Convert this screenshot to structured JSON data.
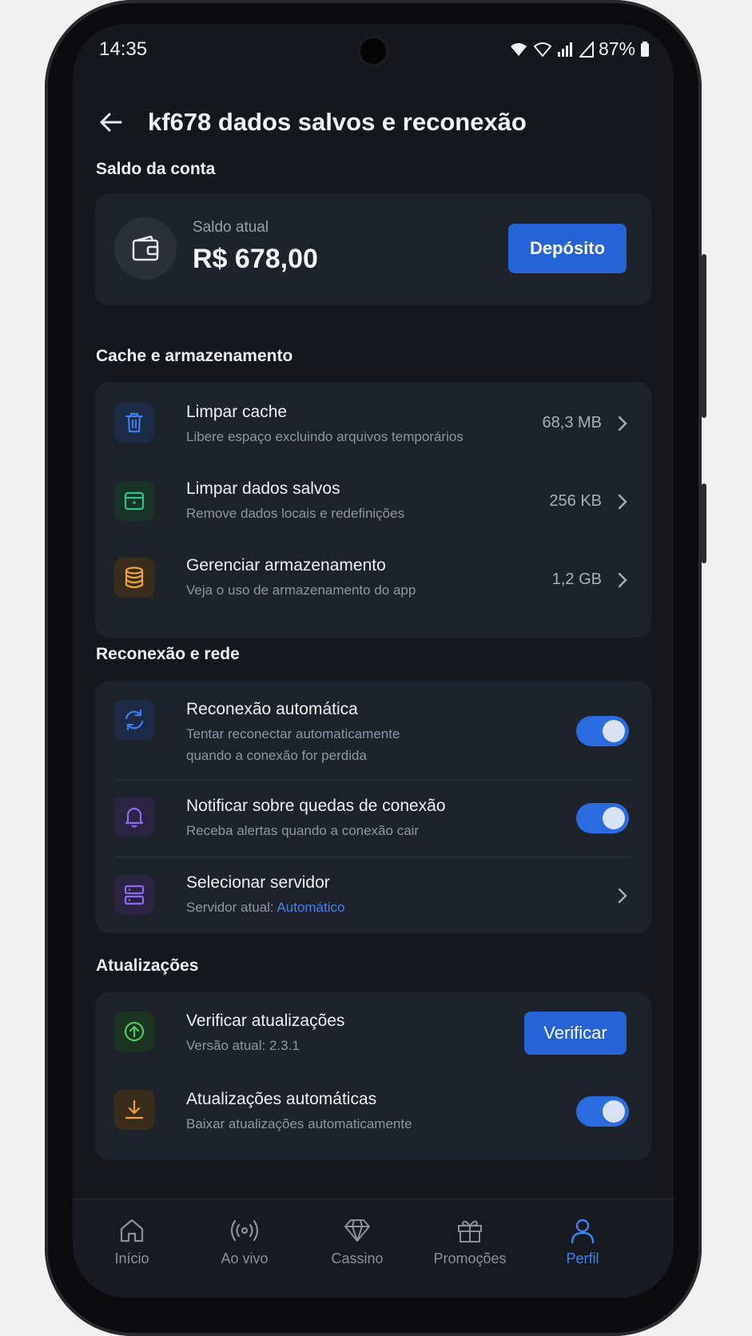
{
  "status_bar": {
    "time": "14:35",
    "battery": "87%"
  },
  "header": {
    "title": "kf678 dados salvos e reconexão"
  },
  "balance": {
    "section_title": "Saldo da conta",
    "label": "Saldo atual",
    "amount": "R$ 678,00",
    "deposit_label": "Depósito"
  },
  "cache": {
    "section_title": "Cache e armazenamento",
    "items": [
      {
        "title": "Limpar cache",
        "subtitle": "Libere espaço excluindo arquivos temporários",
        "size": "68,3 MB",
        "icon": "trash-icon",
        "color": "#3c7df0"
      },
      {
        "title": "Limpar dados salvos",
        "subtitle": "Remove dados locais e redefinições",
        "size": "256 KB",
        "icon": "box-icon",
        "color": "#2fc58a"
      },
      {
        "title": "Gerenciar armazenamento",
        "subtitle": "Veja o uso de armazenamento do app",
        "size": "1,2 GB",
        "icon": "database-icon",
        "color": "#f0a23c"
      }
    ]
  },
  "network": {
    "section_title": "Reconexão e rede",
    "auto_reconnect": {
      "title": "Reconexão automática",
      "subtitle_line1": "Tentar reconectar automaticamente",
      "subtitle_line2": "quando a conexão for perdida",
      "enabled": true
    },
    "notify_drops": {
      "title": "Notificar sobre quedas de conexão",
      "subtitle": "Receba alertas quando a conexão cair",
      "enabled": true
    },
    "server": {
      "title": "Selecionar servidor",
      "subtitle_prefix": "Servidor atual:",
      "current": "Automático"
    }
  },
  "updates": {
    "section_title": "Atualizações",
    "check": {
      "title": "Verificar atualizações",
      "subtitle": "Versão atual: 2.3.1",
      "button_label": "Verificar"
    },
    "auto": {
      "title": "Atualizações automáticas",
      "subtitle": "Baixar atualizações automaticamente",
      "enabled": true
    }
  },
  "nav": {
    "items": [
      {
        "label": "Início",
        "icon": "home-icon"
      },
      {
        "label": "Ao vivo",
        "icon": "live-icon"
      },
      {
        "label": "Cassino",
        "icon": "diamond-icon"
      },
      {
        "label": "Promoções",
        "icon": "gift-icon"
      },
      {
        "label": "Perfil",
        "icon": "user-icon",
        "active": true
      }
    ]
  }
}
